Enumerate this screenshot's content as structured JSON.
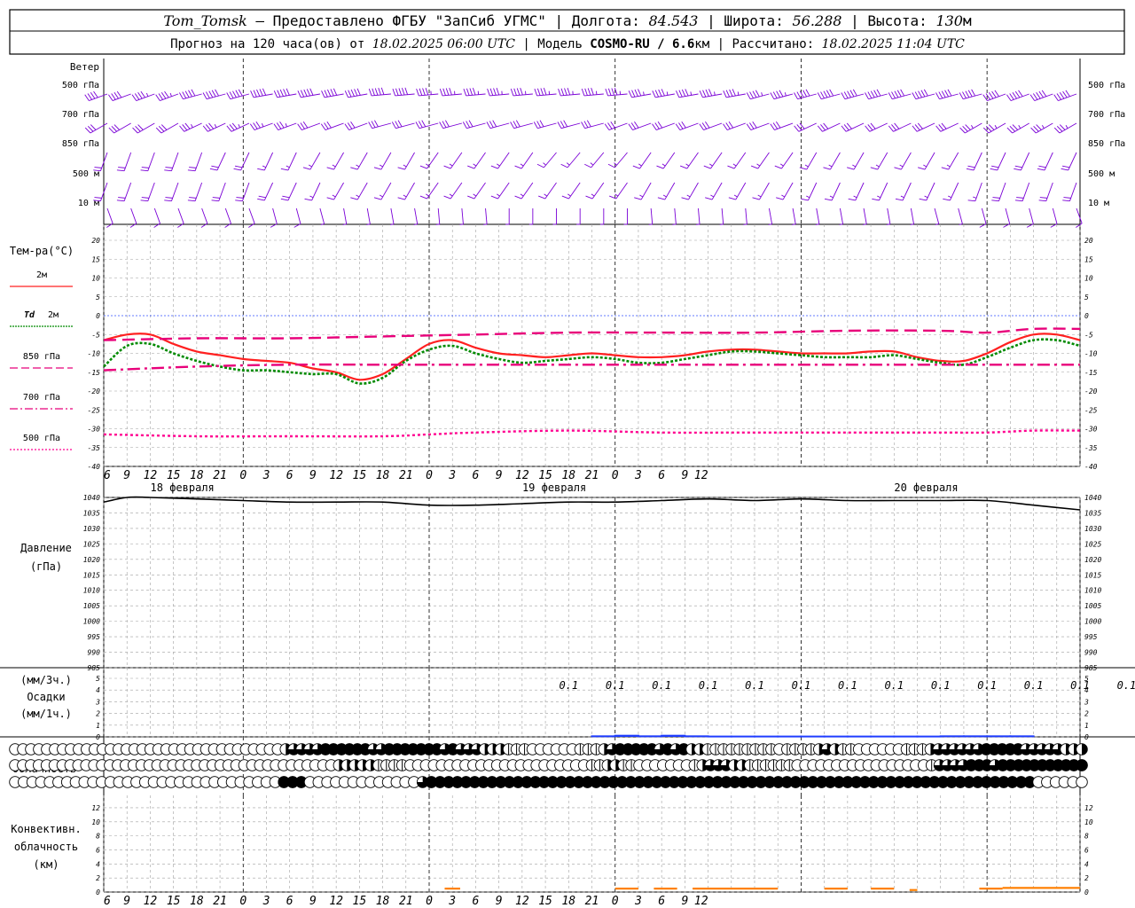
{
  "header": {
    "station_name": "Tom_Tomsk",
    "station_dash": " – ",
    "provider": "Предоставлено ФГБУ \"ЗапСиб УГМС\"",
    "lon_label": "Долгота:",
    "lon_value": "84.543",
    "lat_label": "Широта:",
    "lat_value": "56.288",
    "alt_label": "Высота:",
    "alt_value": "130",
    "alt_unit": "м",
    "forecast_label": "Прогноз на 120 часа(ов) от",
    "forecast_start": "18.02.2025 06:00 UTC",
    "model_label": "Модель",
    "model_name": "COSMO-RU / 6.6",
    "model_unit": "км",
    "calc_label": "Рассчитано:",
    "calc_time": "18.02.2025 11:04 UTC"
  },
  "colors": {
    "wind": "#7a00d6",
    "t2m": "#ff2020",
    "td2m": "#008a00",
    "t850": "#e8007a",
    "t700": "#e8007a",
    "t500": "#ff0090",
    "zero_line": "#3050ff",
    "pressure": "#000000",
    "precip": "#1e3cff",
    "convective": "#ff7f00",
    "grid": "#a0a0a0"
  },
  "time_axis": {
    "hour_labels": [
      "6",
      "9",
      "12",
      "15",
      "18",
      "21",
      "0",
      "3",
      "6",
      "9",
      "12",
      "15",
      "18",
      "21",
      "0",
      "3",
      "6",
      "9",
      "12",
      "15",
      "18",
      "21",
      "0",
      "3",
      "6",
      "9",
      "12"
    ],
    "dates": [
      "18 февраля",
      "19 февраля",
      "20 февраля"
    ]
  },
  "panels": {
    "wind": {
      "title": "Ветер",
      "levels": [
        "500 гПа",
        "700 гПа",
        "850 гПа",
        "500 м",
        "10 м"
      ]
    },
    "temperature": {
      "title": "Тем-ра(°С)",
      "legend": [
        {
          "label": "2м",
          "key": "t2m"
        },
        {
          "label": "Td",
          "label2": "2м",
          "key": "td2m"
        },
        {
          "label": "850 гПа",
          "key": "t850"
        },
        {
          "label": "700 гПа",
          "key": "t700"
        },
        {
          "label": "500 гПа",
          "key": "t500"
        }
      ],
      "ticks": [
        "20",
        "15",
        "10",
        "5",
        "0",
        "-5",
        "-10",
        "-15",
        "-20",
        "-25",
        "-30",
        "-35",
        "-40"
      ]
    },
    "pressure": {
      "title": "Давление",
      "unit": "(гПа)",
      "ticks": [
        "1040",
        "1035",
        "1030",
        "1025",
        "1020",
        "1015",
        "1010",
        "1005",
        "1000",
        "995",
        "990",
        "985"
      ]
    },
    "precip": {
      "unit3h": "(мм/3ч.)",
      "title": "Осадки",
      "unit1h": "(мм/1ч.)",
      "ticks": [
        "5",
        "4",
        "3",
        "2",
        "1",
        "0"
      ],
      "value_labels": [
        "0.1",
        "0.1",
        "0.1",
        "0.1",
        "0.1",
        "0.1",
        "0.1",
        "0.1",
        "0.1",
        "0.1",
        "0.1",
        "0.1",
        "0.1"
      ]
    },
    "cloud": {
      "title": "Облачность",
      "rows": [
        "верхний ярус",
        "средний ярус",
        "нижний ярус"
      ]
    },
    "convective": {
      "title_lines": [
        "Конвективн.",
        "облачность",
        "(км)"
      ],
      "ticks": [
        "12",
        "10",
        "8",
        "6",
        "4",
        "2",
        "0"
      ]
    }
  },
  "chart_data": {
    "type": "line",
    "x_unit": "hours since 18.02.2025 06:00 UTC",
    "x_range": [
      0,
      126
    ],
    "temperature": {
      "ylim": [
        -40,
        20
      ],
      "series": [
        {
          "name": "2м",
          "key": "t2m",
          "x": [
            0,
            3,
            6,
            9,
            12,
            15,
            18,
            21,
            24,
            27,
            30,
            33,
            36,
            39,
            42,
            45,
            48,
            51,
            54,
            57,
            60,
            63,
            66,
            69,
            72,
            75,
            78,
            81,
            84,
            87,
            90,
            93,
            96,
            99,
            102,
            105,
            108,
            111,
            114,
            117,
            120,
            123,
            126
          ],
          "values": [
            -6.5,
            -5,
            -5,
            -7.5,
            -9.5,
            -10.5,
            -11.5,
            -12,
            -12.5,
            -14,
            -15,
            -17,
            -15.5,
            -11.5,
            -7.5,
            -6.5,
            -8.5,
            -10,
            -10.5,
            -11,
            -10.5,
            -10,
            -10.5,
            -11,
            -11,
            -10.5,
            -9.5,
            -9,
            -9,
            -9.5,
            -10,
            -10,
            -10,
            -9.5,
            -9.5,
            -11,
            -12,
            -12,
            -10,
            -7,
            -5,
            -5,
            -6.5
          ]
        },
        {
          "name": "Td 2м",
          "key": "td2m",
          "x": [
            0,
            3,
            6,
            9,
            12,
            15,
            18,
            21,
            24,
            27,
            30,
            33,
            36,
            39,
            42,
            45,
            48,
            51,
            54,
            57,
            60,
            63,
            66,
            69,
            72,
            75,
            78,
            81,
            84,
            87,
            90,
            93,
            96,
            99,
            102,
            105,
            108,
            111,
            114,
            117,
            120,
            123,
            126
          ],
          "values": [
            -13.5,
            -8,
            -7.5,
            -10,
            -12,
            -13.5,
            -14.5,
            -14.5,
            -15,
            -15.5,
            -15.5,
            -18,
            -16.5,
            -12,
            -9,
            -8,
            -10,
            -11.5,
            -12.5,
            -12,
            -11.5,
            -11,
            -11.5,
            -12.5,
            -12.5,
            -11.5,
            -10.5,
            -9.5,
            -9.5,
            -10,
            -10.5,
            -11,
            -11,
            -11,
            -10.5,
            -11.5,
            -12.5,
            -13,
            -11,
            -8.5,
            -6.5,
            -6.5,
            -8
          ]
        },
        {
          "name": "850 гПа",
          "key": "t850",
          "x": [
            0,
            12,
            24,
            36,
            48,
            60,
            72,
            84,
            96,
            108,
            114,
            120,
            126
          ],
          "values": [
            -6.5,
            -6,
            -6,
            -5.5,
            -5,
            -4.5,
            -4.5,
            -4.5,
            -4,
            -4,
            -4.5,
            -3.5,
            -3.5
          ]
        },
        {
          "name": "700 гПа",
          "key": "t700",
          "x": [
            0,
            12,
            24,
            36,
            48,
            60,
            72,
            84,
            96,
            108,
            114,
            120,
            126
          ],
          "values": [
            -14.5,
            -13.5,
            -13,
            -13,
            -13,
            -13,
            -13,
            -13,
            -13,
            -13,
            -13,
            -13,
            -13
          ]
        },
        {
          "name": "500 гПа",
          "key": "t500",
          "x": [
            0,
            12,
            24,
            36,
            42,
            48,
            60,
            72,
            84,
            96,
            108,
            114,
            120,
            126
          ],
          "values": [
            -31.5,
            -32,
            -32,
            -32,
            -31.5,
            -31,
            -30.5,
            -31,
            -31,
            -31,
            -31,
            -31,
            -30.5,
            -30.5
          ]
        }
      ]
    },
    "pressure": {
      "ylim": [
        985,
        1040
      ],
      "x": [
        0,
        3,
        6,
        12,
        18,
        24,
        30,
        36,
        42,
        48,
        54,
        60,
        66,
        72,
        78,
        84,
        90,
        96,
        102,
        108,
        114,
        120,
        126
      ],
      "values": [
        1038.5,
        1040,
        1040,
        1039.5,
        1039,
        1038.5,
        1038.5,
        1038.5,
        1037.5,
        1037.5,
        1038,
        1038.5,
        1038.5,
        1039,
        1039.5,
        1039,
        1039.5,
        1039,
        1039,
        1039,
        1039,
        1037.5,
        1036
      ]
    },
    "precipitation": {
      "ylim": [
        0,
        5
      ],
      "x": [
        60,
        63,
        66,
        69,
        72,
        75,
        78,
        81,
        84,
        87,
        90,
        93,
        96,
        99,
        102,
        105,
        108,
        111,
        114,
        117,
        120,
        123,
        126
      ],
      "values": [
        0,
        0.05,
        0.1,
        0.05,
        0.1,
        0.05,
        0.03,
        0.03,
        0.03,
        0.03,
        0.03,
        0.03,
        0.03,
        0.03,
        0.03,
        0.03,
        0.05,
        0.05,
        0.05,
        0.05,
        0,
        0,
        0
      ]
    },
    "convective_cloud": {
      "ylim": [
        0,
        13
      ],
      "segments": [
        {
          "x0": 44,
          "x1": 46,
          "top": 0.5
        },
        {
          "x0": 66,
          "x1": 69,
          "top": 0.5
        },
        {
          "x0": 71,
          "x1": 74,
          "top": 0.5
        },
        {
          "x0": 76,
          "x1": 87,
          "top": 0.5
        },
        {
          "x0": 93,
          "x1": 96,
          "top": 0.5
        },
        {
          "x0": 99,
          "x1": 102,
          "top": 0.5
        },
        {
          "x0": 104,
          "x1": 105,
          "top": 0.3
        },
        {
          "x0": 113,
          "x1": 116,
          "top": 0.5
        },
        {
          "x0": 116,
          "x1": 126,
          "top": 0.6
        }
      ]
    },
    "cloud_cover": {
      "x_step_hours": 1.5,
      "note_levels": [
        "high",
        "middle",
        "low"
      ],
      "high": [
        0,
        0,
        0,
        0,
        0,
        0,
        0,
        0,
        0,
        0,
        0,
        0,
        0,
        0,
        0,
        0,
        0,
        0,
        0,
        0,
        0,
        0,
        0,
        0,
        0,
        0,
        0,
        0,
        0,
        0,
        0,
        0,
        0,
        0,
        2,
        3,
        3,
        3,
        3,
        4,
        4,
        4,
        4,
        4,
        4,
        3,
        3,
        4,
        4,
        4,
        4,
        4,
        4,
        4,
        3,
        4,
        3,
        3,
        3,
        2,
        2,
        2,
        1,
        1,
        1,
        0,
        0,
        0,
        0,
        0,
        0,
        1,
        1,
        1,
        2,
        3,
        4,
        4,
        4,
        4,
        4,
        3,
        4,
        3,
        4,
        2,
        2,
        1,
        1,
        1,
        1,
        1,
        1,
        1,
        1,
        1,
        0,
        1,
        1,
        1,
        1,
        2,
        3,
        2,
        1,
        1,
        0,
        0,
        0,
        0,
        0,
        0,
        1,
        1,
        1,
        2,
        3,
        3,
        3,
        3,
        3,
        3,
        4,
        4,
        4,
        4,
        4,
        3,
        3,
        3,
        3,
        3,
        2,
        2,
        2
      ],
      "middle": [
        0,
        0,
        0,
        0,
        0,
        0,
        0,
        0,
        0,
        0,
        0,
        0,
        0,
        0,
        0,
        0,
        0,
        0,
        0,
        0,
        0,
        0,
        0,
        0,
        0,
        0,
        0,
        0,
        0,
        0,
        0,
        0,
        0,
        0,
        0,
        0,
        0,
        0,
        0,
        0,
        0,
        2,
        2,
        2,
        2,
        2,
        1,
        1,
        1,
        1,
        0,
        0,
        0,
        0,
        0,
        0,
        0,
        0,
        0,
        0,
        0,
        0,
        0,
        0,
        0,
        0,
        0,
        0,
        0,
        0,
        0,
        0,
        0,
        1,
        1,
        2,
        2,
        1,
        1,
        0,
        0,
        0,
        0,
        0,
        0,
        0,
        1,
        2,
        3,
        3,
        3,
        2,
        2,
        1,
        1,
        1,
        1,
        1,
        1,
        0,
        0,
        0,
        0,
        0,
        0,
        0,
        0,
        0,
        0,
        0,
        0,
        0,
        0,
        0,
        0,
        0,
        1,
        3,
        3,
        3,
        3,
        4,
        4,
        4,
        3,
        4,
        4,
        4,
        4,
        4,
        4,
        4,
        4,
        4,
        4,
        4
      ],
      "low": [
        0,
        0,
        0,
        0,
        0,
        0,
        0,
        0,
        0,
        0,
        0,
        0,
        0,
        0,
        0,
        0,
        0,
        0,
        0,
        0,
        0,
        0,
        0,
        0,
        0,
        0,
        0,
        0,
        0,
        0,
        0,
        4,
        4,
        4,
        0,
        0,
        0,
        0,
        0,
        0,
        0,
        0,
        0,
        0,
        0,
        0,
        0,
        3,
        4,
        4,
        4,
        4,
        4,
        4,
        4,
        4,
        4,
        4,
        4,
        4,
        4,
        4,
        4,
        4,
        4,
        4,
        4,
        4,
        4,
        4,
        4,
        4,
        4,
        4,
        4,
        4,
        4,
        4,
        4,
        4,
        4,
        4,
        4,
        4,
        4,
        4,
        4,
        4,
        4,
        4,
        4,
        4,
        4,
        4,
        4,
        4,
        4,
        4,
        4,
        4,
        4,
        4,
        4,
        4,
        4,
        4,
        4,
        4,
        4,
        4,
        4,
        4,
        4,
        4,
        4,
        4,
        4,
        4,
        0,
        0,
        0,
        0,
        0,
        0
      ]
    },
    "wind": {
      "levels": [
        "500 гПа",
        "700 гПа",
        "850 гПа",
        "500 м",
        "10 м"
      ],
      "direction_from_deg": {
        "500 гПа": [
          250,
          250,
          255,
          255,
          260,
          260,
          260,
          265,
          265,
          265,
          265,
          265,
          265,
          265,
          260,
          260,
          260,
          255,
          255,
          255,
          255,
          255,
          255,
          250,
          250,
          250
        ],
        "700 гПа": [
          240,
          240,
          245,
          245,
          250,
          250,
          250,
          255,
          255,
          255,
          255,
          255,
          255,
          250,
          250,
          250,
          250,
          250,
          245,
          245,
          245,
          245,
          240,
          240,
          240,
          240
        ],
        "850 гПа": [
          200,
          200,
          200,
          205,
          205,
          210,
          210,
          210,
          215,
          215,
          215,
          220,
          220,
          220,
          215,
          215,
          215,
          215,
          210,
          210,
          210,
          210,
          205,
          205,
          205,
          205
        ],
        "500 м": [
          200,
          200,
          200,
          200,
          205,
          205,
          210,
          210,
          215,
          215,
          215,
          215,
          215,
          215,
          210,
          210,
          210,
          210,
          205,
          205,
          205,
          205,
          200,
          200,
          200,
          200
        ],
        "10 м": [
          160,
          160,
          160,
          160,
          165,
          165,
          170,
          170,
          175,
          175,
          180,
          180,
          180,
          180,
          175,
          175,
          175,
          170,
          170,
          170,
          170,
          165,
          165,
          165,
          165,
          160
        ]
      },
      "speed_ms": {
        "500 гПа": [
          20,
          22,
          24,
          24,
          25,
          25,
          24,
          24,
          23,
          23,
          22,
          22,
          22,
          22,
          22,
          22,
          23,
          23,
          24,
          24,
          24,
          24,
          25,
          25,
          26,
          26
        ],
        "700 гПа": [
          15,
          16,
          17,
          17,
          17,
          16,
          16,
          15,
          15,
          15,
          15,
          14,
          14,
          14,
          14,
          15,
          15,
          15,
          16,
          16,
          16,
          16,
          17,
          17,
          18,
          18
        ],
        "850 гПа": [
          9,
          9,
          9,
          9,
          8,
          8,
          8,
          8,
          8,
          7,
          7,
          7,
          7,
          7,
          7,
          7,
          7,
          7,
          8,
          8,
          8,
          8,
          9,
          9,
          9,
          9
        ],
        "500 м": [
          9,
          9,
          9,
          9,
          9,
          8,
          8,
          8,
          8,
          8,
          7,
          7,
          7,
          7,
          7,
          7,
          7,
          8,
          8,
          8,
          8,
          8,
          8,
          9,
          9,
          9
        ],
        "10 м": [
          4,
          4,
          4,
          4,
          4,
          3,
          3,
          3,
          3,
          3,
          3,
          3,
          3,
          3,
          3,
          3,
          3,
          3,
          3,
          3,
          3,
          3,
          4,
          4,
          4,
          4
        ]
      }
    }
  }
}
